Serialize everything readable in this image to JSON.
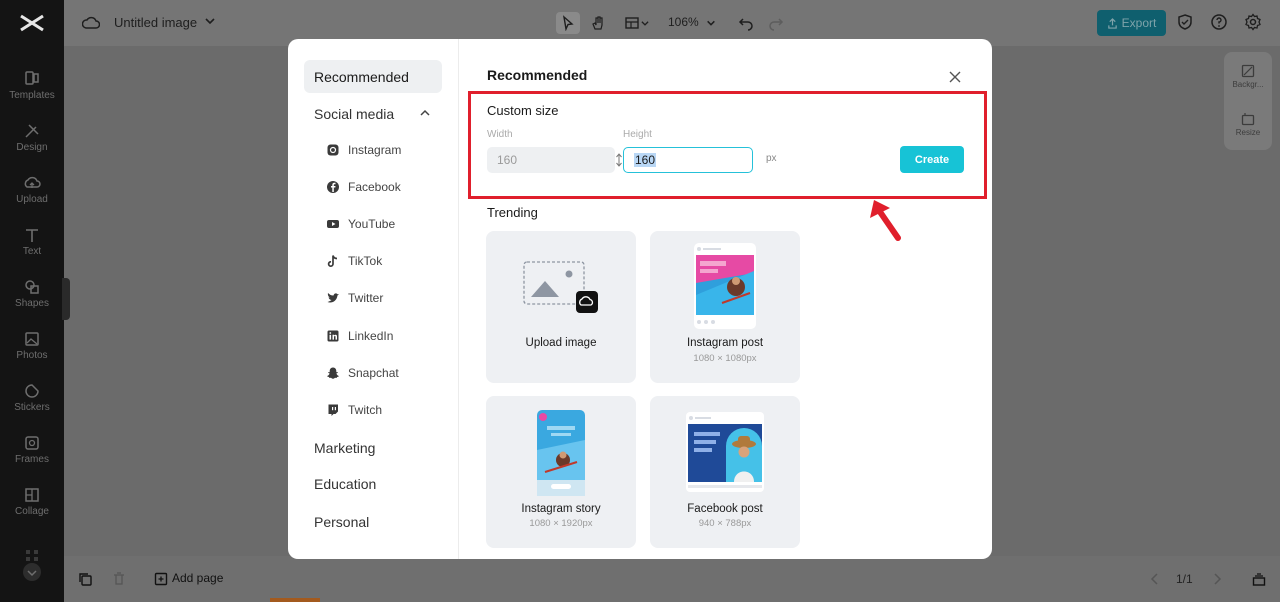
{
  "app": {
    "document_title": "Untitled image"
  },
  "rail": {
    "items": [
      {
        "label": "Templates"
      },
      {
        "label": "Design"
      },
      {
        "label": "Upload"
      },
      {
        "label": "Text"
      },
      {
        "label": "Shapes"
      },
      {
        "label": "Photos"
      },
      {
        "label": "Stickers"
      },
      {
        "label": "Frames"
      },
      {
        "label": "Collage"
      }
    ]
  },
  "toolbar": {
    "zoom": "106%",
    "export_label": "Export"
  },
  "side_panel": {
    "tabs": [
      {
        "label": "Backgr..."
      },
      {
        "label": "Resize"
      }
    ]
  },
  "bottombar": {
    "add_page": "Add page",
    "page_indicator": "1/1"
  },
  "modal": {
    "nav": {
      "recommended": "Recommended",
      "social_media": "Social media",
      "social_items": [
        {
          "label": "Instagram"
        },
        {
          "label": "Facebook"
        },
        {
          "label": "YouTube"
        },
        {
          "label": "TikTok"
        },
        {
          "label": "Twitter"
        },
        {
          "label": "LinkedIn"
        },
        {
          "label": "Snapchat"
        },
        {
          "label": "Twitch"
        }
      ],
      "marketing": "Marketing",
      "education": "Education",
      "personal": "Personal"
    },
    "heading": "Recommended",
    "custom_size": {
      "title": "Custom size",
      "width_label": "Width",
      "height_label": "Height",
      "width_value": "160",
      "height_value": "160",
      "unit": "px",
      "create_label": "Create"
    },
    "trending": {
      "title": "Trending",
      "cards": [
        {
          "name": "Upload image",
          "size": ""
        },
        {
          "name": "Instagram post",
          "size": "1080 × 1080px"
        },
        {
          "name": "Instagram story",
          "size": "1080 × 1920px"
        },
        {
          "name": "Facebook post",
          "size": "940 × 788px"
        }
      ]
    }
  },
  "colors": {
    "accent": "#17c3d6",
    "highlight_annotation": "#e01f2c"
  }
}
